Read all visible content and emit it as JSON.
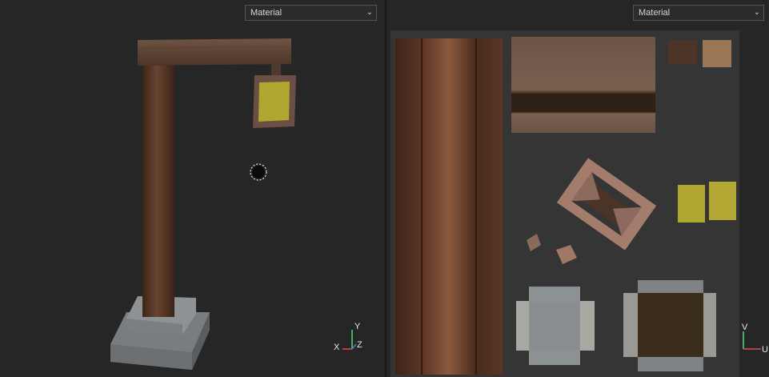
{
  "left_panel": {
    "dropdown_value": "Material",
    "axis": {
      "y": "Y",
      "x": "X",
      "z": "Z"
    }
  },
  "right_panel": {
    "dropdown_value": "Material",
    "axis": {
      "v": "V",
      "u": "U"
    }
  },
  "colors": {
    "background": "#262626",
    "uv_area": "#353535",
    "wood_dark": "#4a2c1c",
    "wood_light": "#7a5038",
    "concrete": "#8d9193",
    "sign_yellow": "#b0a632",
    "axis_green": "#4fd07a",
    "axis_red": "#e04a4a"
  }
}
